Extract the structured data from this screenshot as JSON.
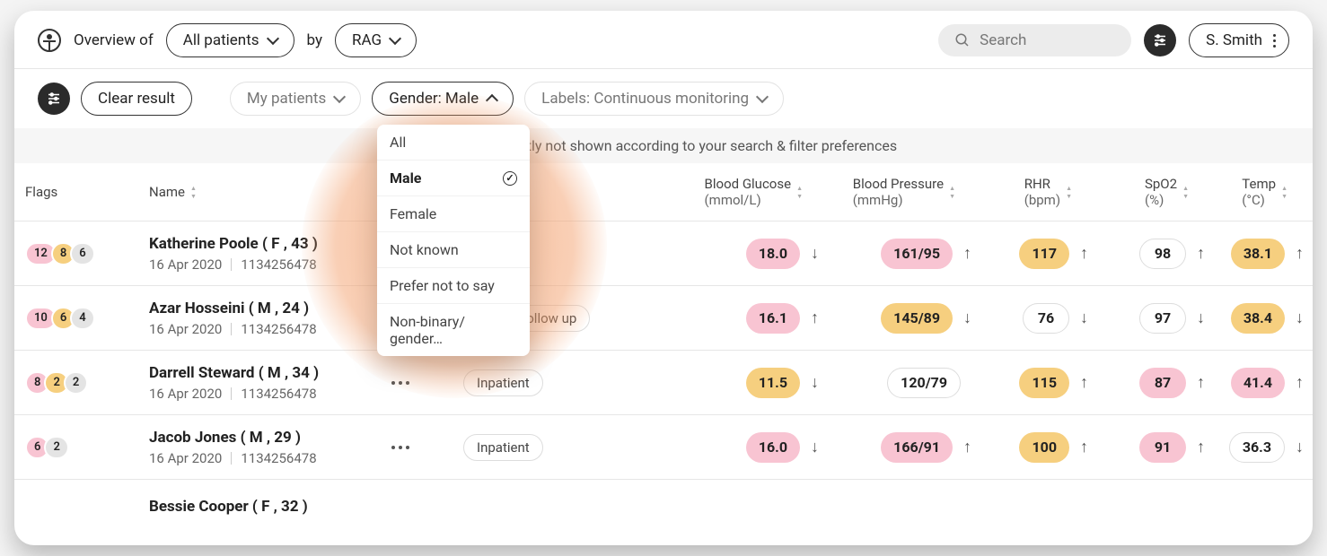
{
  "header": {
    "overview_prefix": "Overview of",
    "scope_label": "All patients",
    "by_text": "by",
    "sort_label": "RAG",
    "search_placeholder": "Search",
    "user_name": "S. Smith"
  },
  "filters": {
    "clear_label": "Clear result",
    "my_patients_label": "My patients",
    "gender_label": "Gender: Male",
    "labels_label": "Labels: Continuous monitoring"
  },
  "gender_dropdown": {
    "items": [
      {
        "label": "All",
        "selected": false
      },
      {
        "label": "Male",
        "selected": true
      },
      {
        "label": "Female",
        "selected": false
      },
      {
        "label": "Not known",
        "selected": false
      },
      {
        "label": "Prefer not to say",
        "selected": false
      },
      {
        "label": "Non-binary/ gender…",
        "selected": false
      }
    ]
  },
  "notice_suffix": "rrently not shown according to your search & filter preferences",
  "columns": {
    "flags": "Flags",
    "name": "Name",
    "glucose_l1": "Blood Glucose",
    "glucose_l2": "(mmol/L)",
    "bp_l1": "Blood Pressure",
    "bp_l2": "(mmHg)",
    "rhr_l1": "RHR",
    "rhr_l2": "(bpm)",
    "spo2_l1": "SpO2",
    "spo2_l2": "(%)",
    "temp_l1": "Temp",
    "temp_l2": "(°C)"
  },
  "rows": [
    {
      "flags": [
        {
          "v": "12",
          "c": "pink"
        },
        {
          "v": "8",
          "c": "amber"
        },
        {
          "v": "6",
          "c": "grey"
        }
      ],
      "name": "Katherine Poole ( F , 43 )",
      "date": "16 Apr 2020",
      "id": "1134256478",
      "tags": [],
      "glucose": {
        "v": "18.0",
        "c": "pink",
        "dir": "↓"
      },
      "bp": {
        "v": "161/95",
        "c": "pink",
        "dir": "↑"
      },
      "rhr": {
        "v": "117",
        "c": "amber",
        "dir": "↑"
      },
      "spo2": {
        "v": "98",
        "c": "white",
        "dir": "↑"
      },
      "temp": {
        "v": "38.1",
        "c": "amber",
        "dir": "↑"
      }
    },
    {
      "flags": [
        {
          "v": "10",
          "c": "pink"
        },
        {
          "v": "6",
          "c": "amber"
        },
        {
          "v": "4",
          "c": "grey"
        }
      ],
      "name": "Azar Hosseini ( M , 24 )",
      "date": "16 Apr 2020",
      "id": "1134256478",
      "tags": [
        "Lost to follow up"
      ],
      "glucose": {
        "v": "16.1",
        "c": "pink",
        "dir": "↑"
      },
      "bp": {
        "v": "145/89",
        "c": "amber",
        "dir": "↓"
      },
      "rhr": {
        "v": "76",
        "c": "white",
        "dir": "↓"
      },
      "spo2": {
        "v": "97",
        "c": "white",
        "dir": "↓"
      },
      "temp": {
        "v": "38.4",
        "c": "amber",
        "dir": "↓"
      }
    },
    {
      "flags": [
        {
          "v": "8",
          "c": "pink"
        },
        {
          "v": "2",
          "c": "amber"
        },
        {
          "v": "2",
          "c": "grey"
        }
      ],
      "name": "Darrell Steward ( M , 34 )",
      "date": "16 Apr 2020",
      "id": "1134256478",
      "tags": [
        "Inpatient"
      ],
      "glucose": {
        "v": "11.5",
        "c": "amber",
        "dir": "↓"
      },
      "bp": {
        "v": "120/79",
        "c": "white",
        "dir": ""
      },
      "rhr": {
        "v": "115",
        "c": "amber",
        "dir": "↑"
      },
      "spo2": {
        "v": "87",
        "c": "pink",
        "dir": "↑"
      },
      "temp": {
        "v": "41.4",
        "c": "pink",
        "dir": "↑"
      }
    },
    {
      "flags": [
        {
          "v": "6",
          "c": "pink"
        },
        {
          "v": "2",
          "c": "grey"
        }
      ],
      "name": "Jacob Jones ( M , 29 )",
      "date": "16 Apr 2020",
      "id": "1134256478",
      "tags": [
        "Inpatient"
      ],
      "glucose": {
        "v": "16.0",
        "c": "pink",
        "dir": "↓"
      },
      "bp": {
        "v": "166/91",
        "c": "pink",
        "dir": "↑"
      },
      "rhr": {
        "v": "100",
        "c": "amber",
        "dir": "↑"
      },
      "spo2": {
        "v": "91",
        "c": "pink",
        "dir": "↑"
      },
      "temp": {
        "v": "36.3",
        "c": "white",
        "dir": "↓"
      }
    }
  ],
  "cutoff_row_name": "Bessie Cooper ( F , 32 )"
}
